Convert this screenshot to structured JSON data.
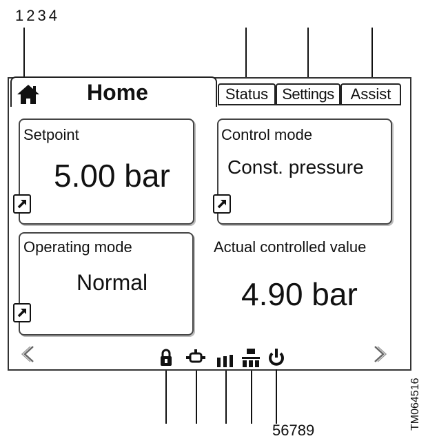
{
  "callouts": {
    "top": [
      "1",
      "2",
      "3",
      "4"
    ],
    "bottom": [
      "5",
      "6",
      "7",
      "8",
      "9"
    ]
  },
  "tabs": {
    "home": "Home",
    "status": "Status",
    "settings": "Settings",
    "assist": "Assist"
  },
  "panels": {
    "setpoint": {
      "label": "Setpoint",
      "value": "5.00 bar"
    },
    "control_mode": {
      "label": "Control mode",
      "value": "Const. pressure"
    },
    "operating_mode": {
      "label": "Operating mode",
      "value": "Normal"
    },
    "actual_value": {
      "label": "Actual controlled value",
      "value": "4.90 bar"
    }
  },
  "status_bar_icons": [
    "lock-icon",
    "pump-icon",
    "signal-bars-icon",
    "network-icon",
    "power-icon"
  ],
  "nav_icons": [
    "chevron-left-icon",
    "chevron-right-icon"
  ],
  "reference": "TM064516"
}
